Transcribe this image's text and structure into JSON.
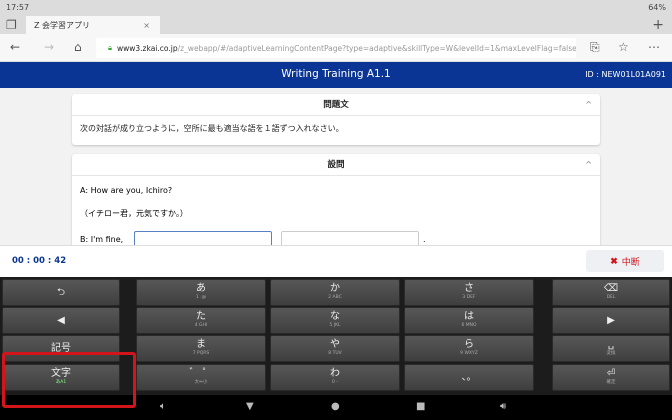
{
  "status": {
    "time": "17:57",
    "battery": "64%"
  },
  "browser": {
    "tab_title": "Z 会学習アプリ",
    "url_host": "www3.zkai.co.jp",
    "url_path": "/z_webapp/#/adaptiveLearningContentPage?type=adaptive&skillType=W&levelId=1&maxLevelFlag=false&to"
  },
  "header": {
    "title": "Writing Training A1.1",
    "id": "ID : NEW01L01A091"
  },
  "cards": [
    {
      "title": "問題文",
      "body": "次の対話が成り立つように，空所に最も適当な語を１語ずつ入れなさい。"
    },
    {
      "title": "設問",
      "lines": [
        "A: How are you, Ichiro?",
        "（イチロー君，元気ですか。）",
        "B: I'm fine,"
      ],
      "end": "."
    }
  ],
  "timer": "00 : 00 : 42",
  "stop_label": "中断",
  "keyboard": {
    "rows": [
      [
        {
          "m": "⮌",
          "s": ""
        },
        {
          "m": "あ",
          "s": "1 .@"
        },
        {
          "m": "か",
          "s": "2 ABC"
        },
        {
          "m": "さ",
          "s": "3 DEF"
        },
        {
          "m": "⌫",
          "s": "DEL"
        }
      ],
      [
        {
          "m": "◀",
          "s": ""
        },
        {
          "m": "た",
          "s": "4 GHI"
        },
        {
          "m": "な",
          "s": "5 JKL"
        },
        {
          "m": "は",
          "s": "6 MNO"
        },
        {
          "m": "▶",
          "s": ""
        }
      ],
      [
        {
          "m": "記号",
          "s": ""
        },
        {
          "m": "ま",
          "s": "7 PQRS"
        },
        {
          "m": "や",
          "s": "8 TUV"
        },
        {
          "m": "ら",
          "s": "9 WXYZ"
        },
        {
          "m": "␣",
          "s": "変換"
        }
      ],
      [
        {
          "m": "文字",
          "s": "あA1"
        },
        {
          "m": "゛ ゜",
          "s": "大⇔小"
        },
        {
          "m": "わ",
          "s": "0 -"
        },
        {
          "m": "、。",
          "s": ""
        },
        {
          "m": "⏎",
          "s": "確定"
        }
      ]
    ]
  },
  "colors": {
    "brand": "#0a3594",
    "stop": "#d0161b",
    "highlight": "#d0161b"
  }
}
